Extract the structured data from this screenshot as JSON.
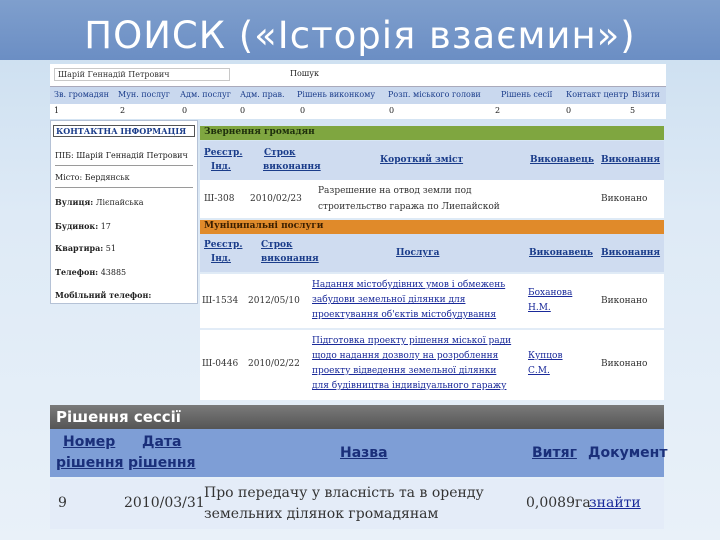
{
  "slide": {
    "title": "ПОИСК («Історія взаємин»)"
  },
  "search": {
    "person": "Шарій Геннадій Петрович",
    "button": "Пошук",
    "columns": [
      "Зв. громадян",
      "Мун. послуг",
      "Адм. послуг",
      "Адм. прав.",
      "Рішень виконкому",
      "Розп. міського голови",
      "Рішень сесії",
      "Контакт центр",
      "Візити"
    ],
    "counts": [
      "1",
      "2",
      "0",
      "0",
      "0",
      "0",
      "2",
      "0",
      "5"
    ]
  },
  "contact": {
    "header": "КОНТАКТНА ІНФОРМАЦІЯ",
    "pib": "ПІБ: Шарій Геннадій Петрович",
    "city": "Місто: Бердянськ",
    "street_label": "Вулиця:",
    "street": "Лієпайська",
    "house_label": "Будинок:",
    "house": "17",
    "apartment_label": "Квартира:",
    "apartment": "51",
    "phone_label": "Телефон:",
    "phone": "43885",
    "mobile_label": "Мобільний телефон:"
  },
  "appeals": {
    "title": "Звернення громадян",
    "cols": {
      "reg1": "Реєстр.",
      "reg2": "Інд.",
      "term1": "Строк",
      "term2": "виконання",
      "summary": "Короткий зміст",
      "executor": "Виконавець",
      "execution": "Виконання"
    },
    "row": {
      "id": "Ш-308",
      "date": "2010/02/23",
      "summary1": "Разрешение на отвод земли под",
      "summary2": "строительство гаража по Лиепайской",
      "status": "Виконано"
    }
  },
  "services": {
    "title": "Муніципальні послуги",
    "cols": {
      "reg1": "Реєстр.",
      "reg2": "Інд.",
      "term1": "Строк",
      "term2": "виконання",
      "service": "Послуга",
      "executor": "Виконавець",
      "execution": "Виконання"
    },
    "rows": [
      {
        "id": "Ш-1534",
        "date": "2012/05/10",
        "l1": "Надання містобудівних умов і обмежень",
        "l2": "забудови земельної ділянки для",
        "l3": "проектування об'єктів містобудування",
        "l4": "",
        "exec1": "Боханова",
        "exec2": "Н.М.",
        "status": "Виконано"
      },
      {
        "id": "Ш-0446",
        "date": "2010/02/22",
        "l1": "Підготовка проекту рішення міської ради",
        "l2": "щодо надання дозволу на розроблення",
        "l3": "проекту відведення земельної ділянки",
        "l4": "для будівництва індивідуального гаражу",
        "exec1": "Купцов",
        "exec2": "С.М.",
        "status": "Виконано"
      }
    ]
  },
  "session": {
    "title": "Рішення сессії",
    "cols": {
      "num1": "Номер",
      "num2": "рішення",
      "date1": "Дата",
      "date2": "рішення",
      "name": "Назва",
      "extract": "Витяг",
      "doc": "Документ"
    },
    "row": {
      "num": "9",
      "date": "2010/03/31",
      "name1": "Про передачу у власність та в оренду",
      "name2": "земельних ділянок громадянам",
      "extract": "0,0089га",
      "doc": "знайти"
    }
  }
}
